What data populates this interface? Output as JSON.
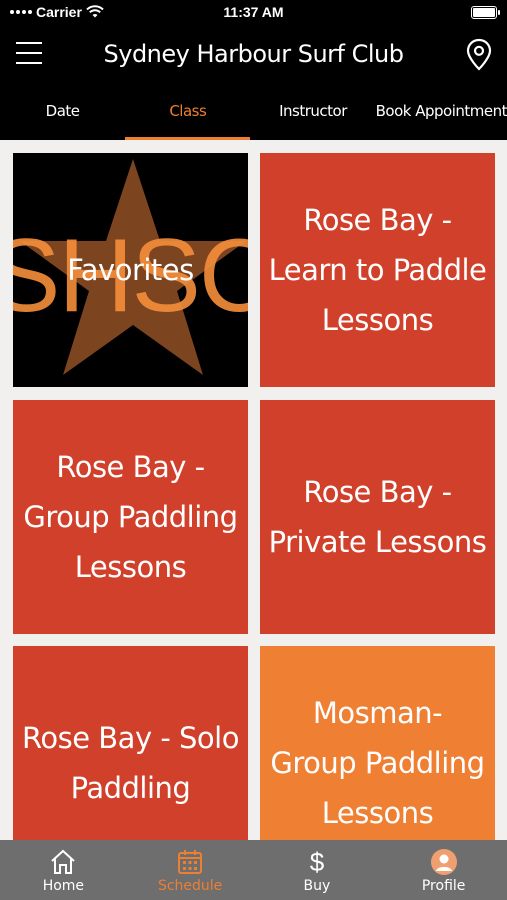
{
  "status_bar": {
    "carrier": "Carrier",
    "time": "11:37 AM"
  },
  "header": {
    "title": "Sydney Harbour Surf Club"
  },
  "tabs": [
    {
      "label": "Date"
    },
    {
      "label": "Class"
    },
    {
      "label": "Instructor"
    },
    {
      "label": "Book Appointment"
    }
  ],
  "tiles": [
    {
      "label": "Favorites",
      "logo_text": "SHSC"
    },
    {
      "label": "Rose Bay - Learn to Paddle Lessons"
    },
    {
      "label": "Rose Bay - Group Paddling Lessons"
    },
    {
      "label": "Rose Bay - Private Lessons"
    },
    {
      "label": "Rose Bay - Solo Paddling"
    },
    {
      "label": "Mosman- Group Paddling Lessons"
    }
  ],
  "bottom_nav": [
    {
      "label": "Home",
      "icon": "home-icon"
    },
    {
      "label": "Schedule",
      "icon": "calendar-icon"
    },
    {
      "label": "Buy",
      "icon": "dollar-icon"
    },
    {
      "label": "Profile",
      "icon": "avatar-icon"
    }
  ],
  "colors": {
    "accent": "#ed7f33",
    "tile_red": "#d0402a",
    "tile_orange": "#ee7f33",
    "bottom_bar": "#6e6e6e"
  }
}
